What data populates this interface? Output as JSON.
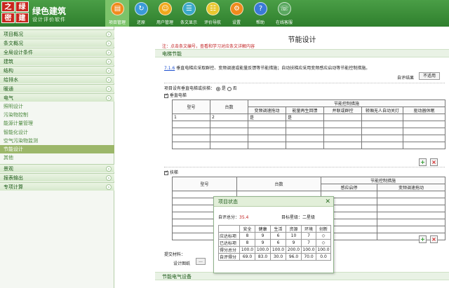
{
  "brand": {
    "logo_chars": [
      "之",
      "绿",
      "密",
      "建"
    ],
    "title": "绿色建筑",
    "subtitle": "设计评价软件"
  },
  "nav": [
    {
      "label": "项目管理",
      "icon": "folder-icon",
      "glyph": "▤",
      "color": "#f08a1c",
      "active": true
    },
    {
      "label": "还原",
      "icon": "refresh-icon",
      "glyph": "↻",
      "color": "#3a9ad8",
      "active": false
    },
    {
      "label": "用户管理",
      "icon": "user-icon",
      "glyph": "☺",
      "color": "#f0a81c",
      "active": false
    },
    {
      "label": "条文显示",
      "icon": "document-icon",
      "glyph": "☰",
      "color": "#3aa8c8",
      "active": false
    },
    {
      "label": "评价导航",
      "icon": "list-icon",
      "glyph": "☷",
      "color": "#e8c830",
      "active": false
    },
    {
      "label": "设置",
      "icon": "gear-icon",
      "glyph": "⚙",
      "color": "#f08a1c",
      "active": false
    },
    {
      "label": "帮助",
      "icon": "help-icon",
      "glyph": "?",
      "color": "#3a7ad8",
      "active": false
    },
    {
      "label": "在线客服",
      "icon": "support-icon",
      "glyph": "☏",
      "color": "#5aa860",
      "active": false
    }
  ],
  "sidebar": [
    {
      "label": "项目概况",
      "type": "section"
    },
    {
      "label": "条文概况",
      "type": "section"
    },
    {
      "label": "全局设计条件",
      "type": "section"
    },
    {
      "label": "建筑",
      "type": "section"
    },
    {
      "label": "结构",
      "type": "section"
    },
    {
      "label": "给排水",
      "type": "section"
    },
    {
      "label": "暖通",
      "type": "section"
    },
    {
      "label": "电气",
      "type": "section"
    },
    {
      "label": "照明设计",
      "type": "sub"
    },
    {
      "label": "污染物控制",
      "type": "sub"
    },
    {
      "label": "能源计量管理",
      "type": "sub"
    },
    {
      "label": "智能化设计",
      "type": "sub"
    },
    {
      "label": "空气污染物监测",
      "type": "sub"
    },
    {
      "label": "节能设计",
      "type": "sub",
      "selected": true
    },
    {
      "label": "其他",
      "type": "sub"
    },
    {
      "label": "景观",
      "type": "section"
    },
    {
      "label": "报表输出",
      "type": "section"
    },
    {
      "label": "专项计算",
      "type": "section"
    }
  ],
  "main": {
    "title": "节能设计",
    "note": "注：点击条文编号，查看和学习对应条文详解内容",
    "section1": "电梯节能",
    "clause_id": "7.1.6",
    "clause_text": " 垂直电梯应采取群控、变频调速或能量反馈等节能措施；自动扶梯应采用变频感应启动等节能控制措施。",
    "self_eval_label": "自评结果",
    "self_eval_btn": "不适用",
    "project_question": "项目设有垂直电梯或扶梯：",
    "yes": "是",
    "no": "否",
    "elevator_label": "垂直电梯",
    "escalator_label": "扶梯",
    "elev_table": {
      "col_model": "型号",
      "col_count": "台数",
      "group_header": "节能控制措施",
      "sub_cols": [
        "变频调速拖动",
        "能量再生回馈",
        "并联或群控",
        "轿厢无人自动关灯",
        "驱动器休眠"
      ],
      "rows": [
        [
          "1",
          "2",
          "是",
          "是",
          "",
          "",
          ""
        ]
      ]
    },
    "esc_table": {
      "col_model": "型号",
      "col_count": "台数",
      "group_header": "节能控制措施",
      "sub_cols": [
        "感应启停",
        "变频调速拖动"
      ]
    },
    "submit_label": "提交材料：",
    "design_label": "设计图纸",
    "browse_btn": "...",
    "section2": "节能电气设备"
  },
  "popup": {
    "title": "项目状态",
    "score_label": "自评总分：",
    "score_value": "35.4",
    "target_label": "目标星级：二星级",
    "headers": [
      "",
      "安全",
      "健康",
      "生活",
      "资源",
      "环境",
      "创新"
    ],
    "rows": [
      [
        "应达标项",
        "8",
        "9",
        "6",
        "10",
        "7",
        "◇"
      ],
      [
        "已达标项",
        "8",
        "9",
        "6",
        "9",
        "7",
        "◇"
      ],
      [
        "得分总分",
        "100.0",
        "100.0",
        "100.0",
        "200.0",
        "100.0",
        "100.0"
      ],
      [
        "自评得分",
        "69.0",
        "83.0",
        "30.0",
        "96.0",
        "70.0",
        "0.0"
      ]
    ]
  }
}
